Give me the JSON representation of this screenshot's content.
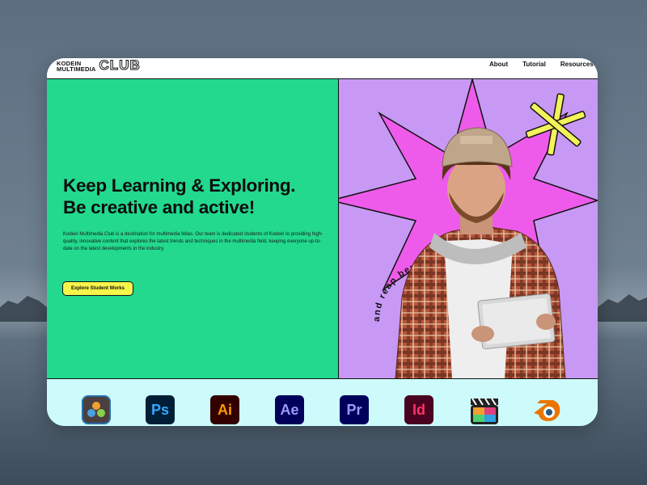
{
  "logo": {
    "line1": "KODEIN",
    "line2": "MULTIMEDIA",
    "big": "CLUB"
  },
  "nav": {
    "items": [
      "About",
      "Tutorial",
      "Resources"
    ]
  },
  "hero": {
    "title_line1": "Keep Learning & Exploring.",
    "title_line2": "Be creative and active!",
    "description": "Kodein Multimedia Club is a destination for multimedia fellas. Our team is dedicated students of Kodein to providing high-quality, innovative content that explores the latest trends and techniques in the multimedia field, keeping everyone up-to-date on the latest developments in the industry.",
    "cta_label": "Explore Student Works",
    "circular_text": "and reap benefits now * register , enroll ,"
  },
  "tools": {
    "items": [
      {
        "icon": "davinci-resolve-icon"
      },
      {
        "icon": "photoshop-icon",
        "label": "Ps"
      },
      {
        "icon": "illustrator-icon",
        "label": "Ai"
      },
      {
        "icon": "after-effects-icon",
        "label": "Ae"
      },
      {
        "icon": "premiere-pro-icon",
        "label": "Pr"
      },
      {
        "icon": "indesign-icon",
        "label": "Id"
      },
      {
        "icon": "final-cut-pro-icon"
      },
      {
        "icon": "blender-icon"
      }
    ]
  },
  "colors": {
    "hero_green": "#22d98e",
    "hero_purple": "#c799f5",
    "star_pink": "#ee5bea",
    "star_yellow": "#f3f35b",
    "cta_yellow": "#f6f54a",
    "tools_bg": "#cdfbfb"
  }
}
